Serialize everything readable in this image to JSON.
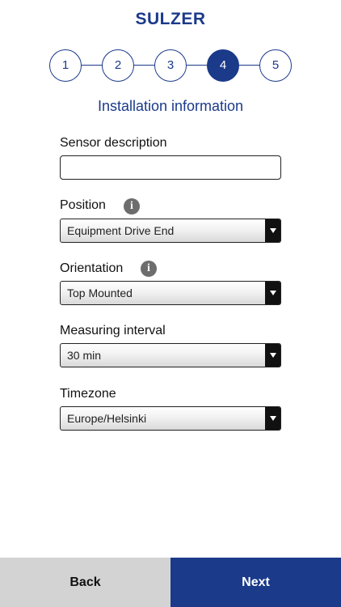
{
  "brand": {
    "logo_text": "SULZER"
  },
  "stepper": {
    "steps": [
      "1",
      "2",
      "3",
      "4",
      "5"
    ],
    "current_step": "4"
  },
  "section_title": "Installation information",
  "fields": {
    "sensor_description": {
      "label": "Sensor description",
      "value": ""
    },
    "position": {
      "label": "Position",
      "value": "Equipment Drive End",
      "icon": "info-icon"
    },
    "orientation": {
      "label": "Orientation",
      "value": "Top Mounted",
      "icon": "info-icon"
    },
    "measuring_interval": {
      "label": "Measuring interval",
      "value": "30 min"
    },
    "timezone": {
      "label": "Timezone",
      "value": "Europe/Helsinki"
    }
  },
  "footer": {
    "back_label": "Back",
    "next_label": "Next"
  },
  "colors": {
    "brand_blue": "#1b3a8a",
    "back_gray": "#d3d3d3",
    "info_gray": "#6d6d6d"
  }
}
